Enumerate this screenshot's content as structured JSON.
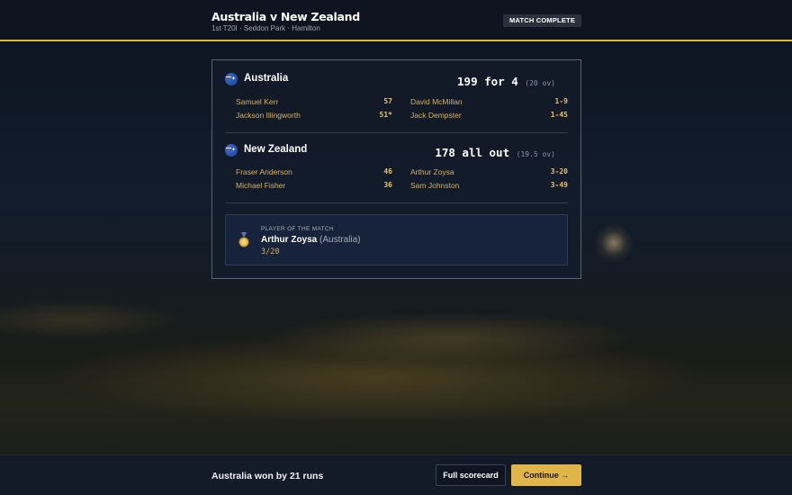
{
  "header": {
    "title": "Australia v New Zealand",
    "subtitle": "1st T20I · Seddon Park · Hamilton",
    "status": "MATCH COMPLETE"
  },
  "innings": [
    {
      "team": "Australia",
      "score": "199 for 4",
      "overs": "(20 ov)",
      "batters": [
        {
          "name": "Samuel Kerr",
          "runs": "57"
        },
        {
          "name": "Jackson Illingworth",
          "runs": "51*"
        }
      ],
      "bowlers": [
        {
          "name": "David McMillan",
          "figures": "1-9"
        },
        {
          "name": "Jack Dempster",
          "figures": "1-45"
        }
      ]
    },
    {
      "team": "New Zealand",
      "score": "178 all out",
      "overs": "(19.5 ov)",
      "batters": [
        {
          "name": "Fraser Anderson",
          "runs": "46"
        },
        {
          "name": "Michael Fisher",
          "runs": "36"
        }
      ],
      "bowlers": [
        {
          "name": "Arthur Zoysa",
          "figures": "3-20"
        },
        {
          "name": "Sam Johnston",
          "figures": "3-49"
        }
      ]
    }
  ],
  "player_of_match": {
    "label": "PLAYER OF THE MATCH",
    "name": "Arthur Zoysa",
    "team": "(Australia)",
    "figures": "3/20"
  },
  "footer": {
    "result": "Australia won by 21 runs",
    "scorecard_label": "Full scorecard",
    "continue_label": "Continue →"
  },
  "colors": {
    "accent": "#e0b64b",
    "background": "#0f1520"
  },
  "icons": {
    "team_flag": "flag-icon",
    "medal": "medal-icon"
  }
}
